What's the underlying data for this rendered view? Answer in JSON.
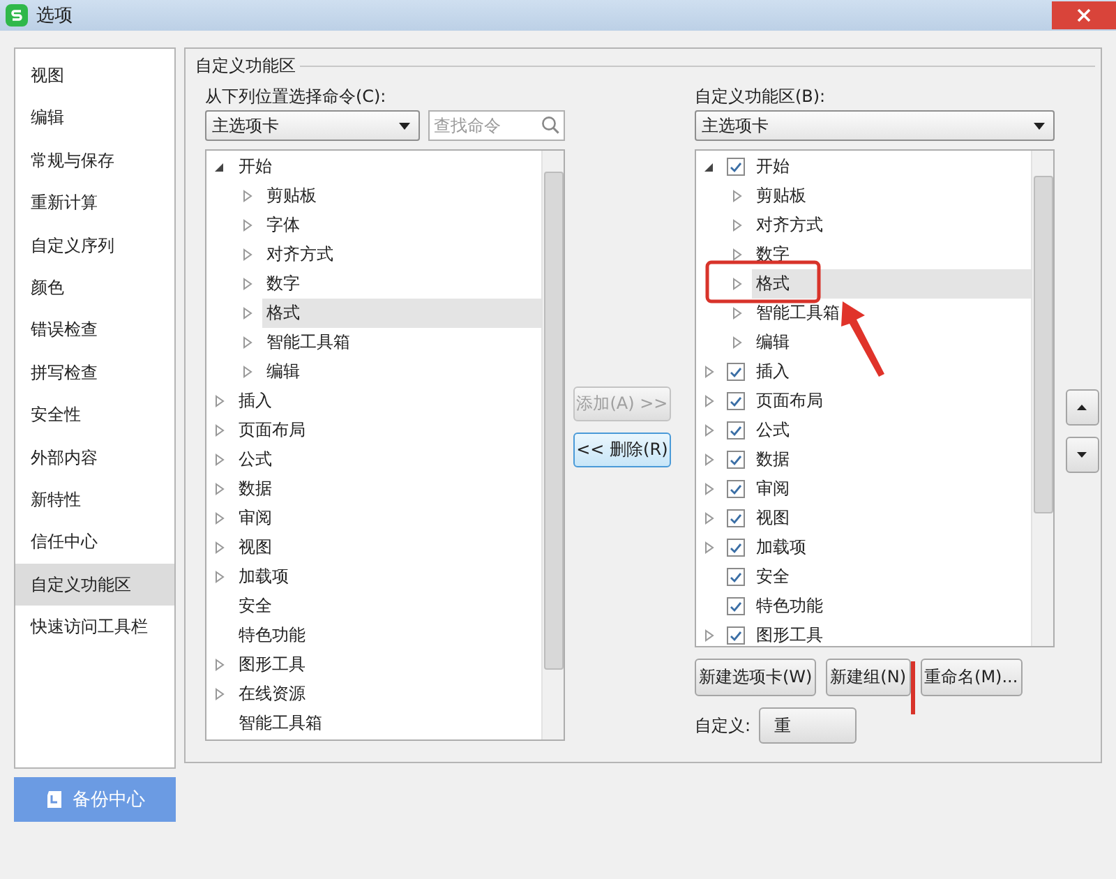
{
  "window": {
    "title": "选项"
  },
  "sidebar": {
    "items": [
      {
        "label": "视图",
        "selected": false
      },
      {
        "label": "编辑",
        "selected": false
      },
      {
        "label": "常规与保存",
        "selected": false
      },
      {
        "label": "重新计算",
        "selected": false
      },
      {
        "label": "自定义序列",
        "selected": false
      },
      {
        "label": "颜色",
        "selected": false
      },
      {
        "label": "错误检查",
        "selected": false
      },
      {
        "label": "拼写检查",
        "selected": false
      },
      {
        "label": "安全性",
        "selected": false
      },
      {
        "label": "外部内容",
        "selected": false
      },
      {
        "label": "新特性",
        "selected": false
      },
      {
        "label": "信任中心",
        "selected": false
      },
      {
        "label": "自定义功能区",
        "selected": true
      },
      {
        "label": "快速访问工具栏",
        "selected": false
      }
    ],
    "backup_button": "备份中心"
  },
  "group_title": "自定义功能区",
  "commands": {
    "label": "从下列位置选择命令(C):",
    "dropdown": "主选项卡",
    "search": {
      "placeholder": "查找命令"
    },
    "tree": [
      {
        "label": "开始",
        "kind": "group",
        "expanded": true,
        "selected": false,
        "children": [
          {
            "label": "剪贴板",
            "kind": "group",
            "expanded": false,
            "selected": false
          },
          {
            "label": "字体",
            "kind": "group",
            "expanded": false,
            "selected": false
          },
          {
            "label": "对齐方式",
            "kind": "group",
            "expanded": false,
            "selected": false
          },
          {
            "label": "数字",
            "kind": "group",
            "expanded": false,
            "selected": false
          },
          {
            "label": "格式",
            "kind": "group",
            "expanded": false,
            "selected": true
          },
          {
            "label": "智能工具箱",
            "kind": "group",
            "expanded": false,
            "selected": false
          },
          {
            "label": "编辑",
            "kind": "group",
            "expanded": false,
            "selected": false
          }
        ]
      },
      {
        "label": "插入",
        "kind": "group",
        "expanded": false,
        "selected": false
      },
      {
        "label": "页面布局",
        "kind": "group",
        "expanded": false,
        "selected": false
      },
      {
        "label": "公式",
        "kind": "group",
        "expanded": false,
        "selected": false
      },
      {
        "label": "数据",
        "kind": "group",
        "expanded": false,
        "selected": false
      },
      {
        "label": "审阅",
        "kind": "group",
        "expanded": false,
        "selected": false
      },
      {
        "label": "视图",
        "kind": "group",
        "expanded": false,
        "selected": false
      },
      {
        "label": "加载项",
        "kind": "group",
        "expanded": false,
        "selected": false
      },
      {
        "label": "安全",
        "kind": "command",
        "selected": false
      },
      {
        "label": "特色功能",
        "kind": "command",
        "selected": false
      },
      {
        "label": "图形工具",
        "kind": "group",
        "expanded": false,
        "selected": false
      },
      {
        "label": "在线资源",
        "kind": "group",
        "expanded": false,
        "selected": false
      },
      {
        "label": "智能工具箱",
        "kind": "command",
        "selected": false
      }
    ]
  },
  "move_buttons": [
    {
      "label": "添加(A) >>",
      "disabled": true
    },
    {
      "label": "<< 删除(R)",
      "disabled": false
    }
  ],
  "ribbon": {
    "label": "自定义功能区(B):",
    "dropdown": "主选项卡",
    "tree": [
      {
        "label": "开始",
        "kind": "group",
        "expanded": true,
        "checked": true,
        "selected": false,
        "children": [
          {
            "label": "剪贴板",
            "kind": "group",
            "expanded": false,
            "selected": false
          },
          {
            "label": "对齐方式",
            "kind": "group",
            "expanded": false,
            "selected": false
          },
          {
            "label": "数字",
            "kind": "group",
            "expanded": false,
            "selected": false
          },
          {
            "label": "格式",
            "kind": "group",
            "expanded": false,
            "selected": true
          },
          {
            "label": "智能工具箱",
            "kind": "group",
            "expanded": false,
            "selected": false
          },
          {
            "label": "编辑",
            "kind": "group",
            "expanded": false,
            "selected": false
          }
        ]
      },
      {
        "label": "插入",
        "kind": "group",
        "expanded": false,
        "checked": true,
        "selected": false
      },
      {
        "label": "页面布局",
        "kind": "group",
        "expanded": false,
        "checked": true,
        "selected": false
      },
      {
        "label": "公式",
        "kind": "group",
        "expanded": false,
        "checked": true,
        "selected": false
      },
      {
        "label": "数据",
        "kind": "group",
        "expanded": false,
        "checked": true,
        "selected": false
      },
      {
        "label": "审阅",
        "kind": "group",
        "expanded": false,
        "checked": true,
        "selected": false
      },
      {
        "label": "视图",
        "kind": "group",
        "expanded": false,
        "checked": true,
        "selected": false
      },
      {
        "label": "加载项",
        "kind": "group",
        "expanded": false,
        "checked": true,
        "selected": false
      },
      {
        "label": "安全",
        "kind": "command",
        "checked": true,
        "selected": false
      },
      {
        "label": "特色功能",
        "kind": "command",
        "checked": true,
        "selected": false
      },
      {
        "label": "图形工具",
        "kind": "group",
        "expanded": false,
        "checked": true,
        "selected": false
      }
    ],
    "buttons": [
      "新建选项卡(W)",
      "新建组(N)",
      "重命名(M)..."
    ],
    "customize_label": "自定义:",
    "reset_button": "重"
  }
}
